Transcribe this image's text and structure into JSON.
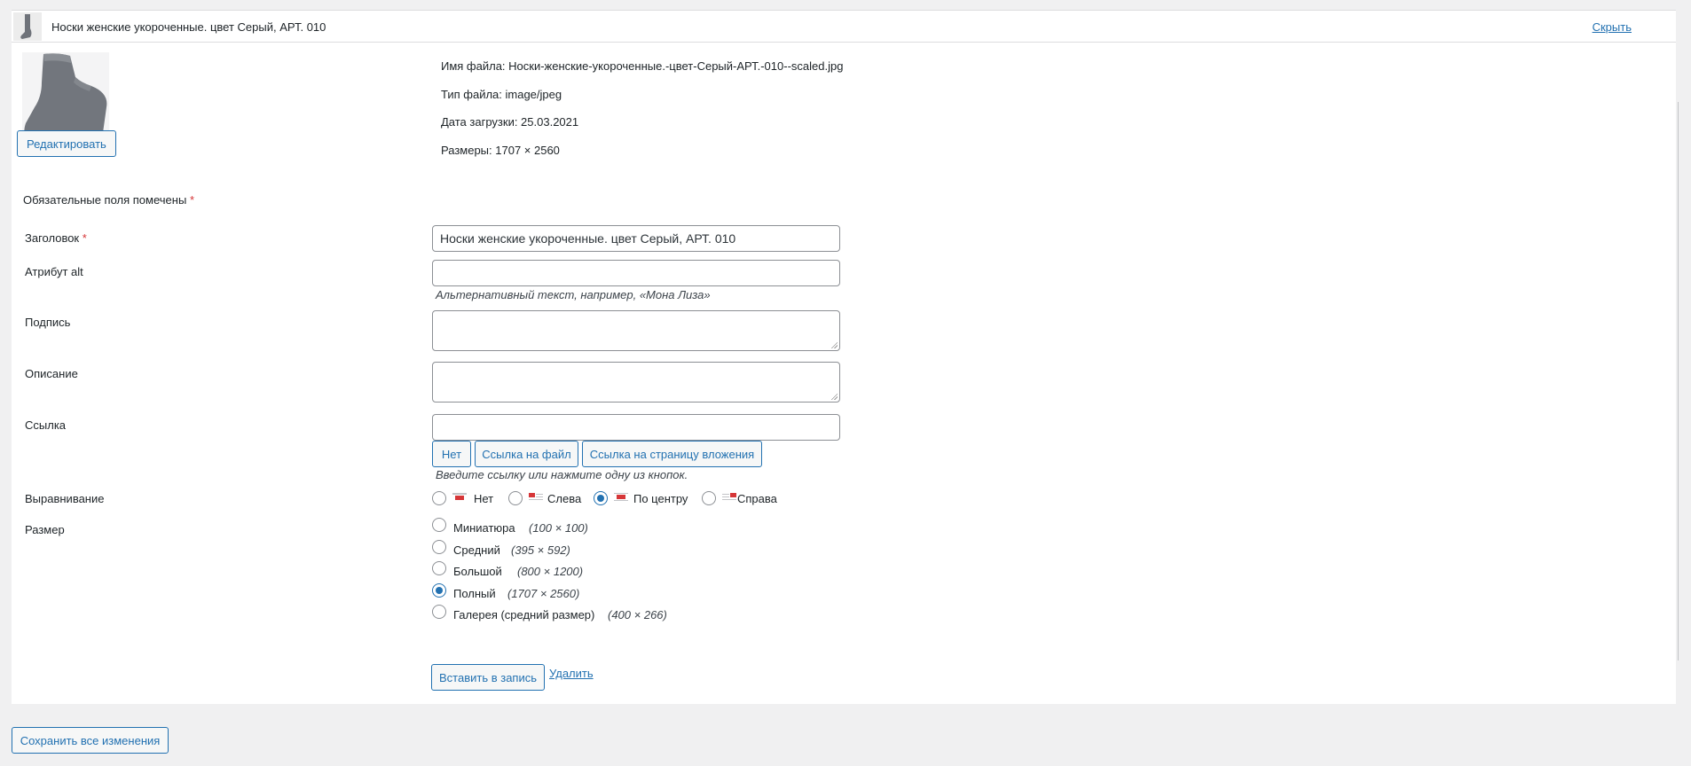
{
  "header": {
    "title": "Носки женские укороченные. цвет Серый, АРТ. 010",
    "hide_link": "Скрыть"
  },
  "file_info": {
    "filename": "Имя файла: Носки-женские-укороченные.-цвет-Серый-АРТ.-010--scaled.jpg",
    "filetype": "Тип файла: image/jpeg",
    "upload_date": "Дата загрузки: 25.03.2021",
    "dimensions": "Размеры: 1707 × 2560"
  },
  "edit_button": "Редактировать",
  "required_note": {
    "text": "Обязательные поля помечены",
    "star": "*"
  },
  "fields": {
    "title": {
      "label": "Заголовок",
      "star": "*",
      "value": "Носки женские укороченные. цвет Серый, АРТ. 010"
    },
    "alt": {
      "label": "Атрибут alt",
      "value": "",
      "help": "Альтернативный текст, например, «Мона Лиза»"
    },
    "caption": {
      "label": "Подпись",
      "value": ""
    },
    "description": {
      "label": "Описание",
      "value": ""
    },
    "link": {
      "label": "Ссылка",
      "value": "",
      "buttons": [
        "Нет",
        "Ссылка на файл",
        "Ссылка на страницу вложения"
      ],
      "help": "Введите ссылку или нажмите одну из кнопок."
    }
  },
  "alignment": {
    "label": "Выравнивание",
    "options": [
      "Нет",
      "Слева",
      "По центру",
      "Справа"
    ],
    "selected": "По центру"
  },
  "size": {
    "label": "Размер",
    "options": [
      {
        "name": "Миниатюра",
        "dims": "(100 × 100)"
      },
      {
        "name": "Средний",
        "dims": "(395 × 592)"
      },
      {
        "name": "Большой",
        "dims": "(800 × 1200)"
      },
      {
        "name": "Полный",
        "dims": "(1707 × 2560)"
      },
      {
        "name": "Галерея (средний размер)",
        "dims": "(400 × 266)"
      }
    ],
    "selected": "Полный"
  },
  "actions": {
    "insert": "Вставить в запись",
    "delete": "Удалить",
    "save_all": "Сохранить все изменения"
  },
  "colors": {
    "accent": "#2271b1",
    "required": "#d63638",
    "background": "#f0f0f1"
  }
}
